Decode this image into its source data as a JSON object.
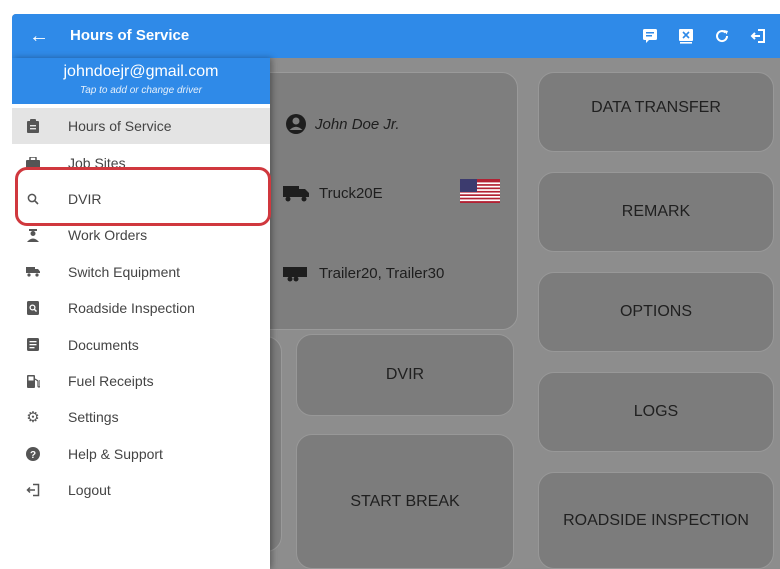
{
  "appbar": {
    "title": "Hours of Service",
    "icons": [
      "back-arrow-icon",
      "message-icon",
      "data-export-icon",
      "refresh-icon",
      "logout-icon"
    ]
  },
  "drawer": {
    "email": "johndoejr@gmail.com",
    "hint": "Tap to add or change driver",
    "items": [
      {
        "label": "Hours of Service",
        "icon": "clipboard-icon"
      },
      {
        "label": "Job Sites",
        "icon": "briefcase-icon"
      },
      {
        "label": "DVIR",
        "icon": "search-icon"
      },
      {
        "label": "Work Orders",
        "icon": "worker-icon"
      },
      {
        "label": "Switch Equipment",
        "icon": "truck-icon"
      },
      {
        "label": "Roadside Inspection",
        "icon": "inspection-icon"
      },
      {
        "label": "Documents",
        "icon": "document-icon"
      },
      {
        "label": "Fuel Receipts",
        "icon": "fuel-icon"
      },
      {
        "label": "Settings",
        "icon": "gear-icon"
      },
      {
        "label": "Help & Support",
        "icon": "help-icon"
      },
      {
        "label": "Logout",
        "icon": "logout-icon"
      }
    ]
  },
  "main": {
    "driver_name": "John Doe Jr.",
    "truck": "Truck20E",
    "trailers": "Trailer20, Trailer30",
    "buttons": {
      "data_transfer": "DATA TRANSFER",
      "remark": "REMARK",
      "options": "OPTIONS",
      "logs": "LOGS",
      "roadside_inspection": "ROADSIDE INSPECTION",
      "dvir": "DVIR",
      "start_break": "START BREAK"
    }
  },
  "colors": {
    "primary": "#2f8ae8",
    "highlight": "#d0383e",
    "scrim": "#8d8d8d"
  }
}
